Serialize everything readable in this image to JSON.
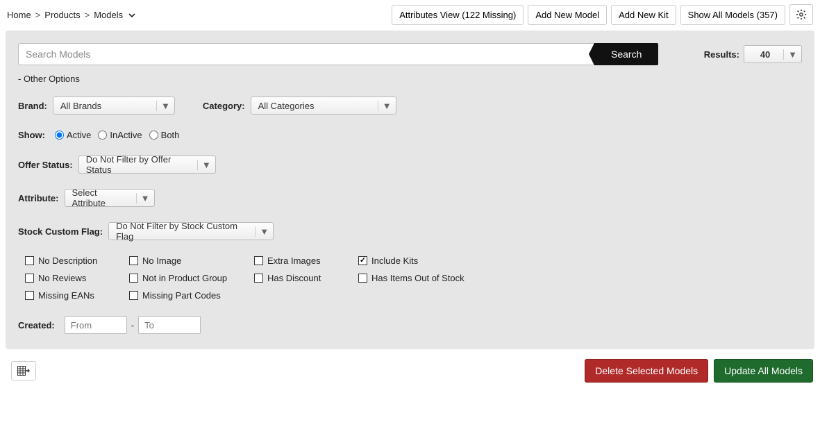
{
  "breadcrumb": {
    "home": "Home",
    "products": "Products",
    "models": "Models"
  },
  "topbar": {
    "attributes_view": "Attributes View (122 Missing)",
    "add_new_model": "Add New Model",
    "add_new_kit": "Add New Kit",
    "show_all_models": "Show All Models (357)"
  },
  "search": {
    "placeholder": "Search Models",
    "button": "Search"
  },
  "results": {
    "label": "Results:",
    "value": "40"
  },
  "other_options": "- Other Options",
  "filters": {
    "brand_label": "Brand:",
    "brand_value": "All Brands",
    "category_label": "Category:",
    "category_value": "All Categories",
    "show_label": "Show:",
    "show_options": {
      "active": "Active",
      "inactive": "InActive",
      "both": "Both"
    },
    "offer_status_label": "Offer Status:",
    "offer_status_value": "Do Not Filter by Offer Status",
    "attribute_label": "Attribute:",
    "attribute_value": "Select Attribute",
    "stock_flag_label": "Stock Custom Flag:",
    "stock_flag_value": "Do Not Filter by Stock Custom Flag"
  },
  "checks": {
    "no_description": "No Description",
    "no_image": "No Image",
    "extra_images": "Extra Images",
    "include_kits": "Include Kits",
    "no_reviews": "No Reviews",
    "not_in_product_group": "Not in Product Group",
    "has_discount": "Has Discount",
    "has_items_out_of_stock": "Has Items Out of Stock",
    "missing_eans": "Missing EANs",
    "missing_part_codes": "Missing Part Codes"
  },
  "created": {
    "label": "Created:",
    "from_ph": "From",
    "to_ph": "To",
    "sep": "-"
  },
  "footer": {
    "delete_selected": "Delete Selected Models",
    "update_all": "Update All Models"
  }
}
